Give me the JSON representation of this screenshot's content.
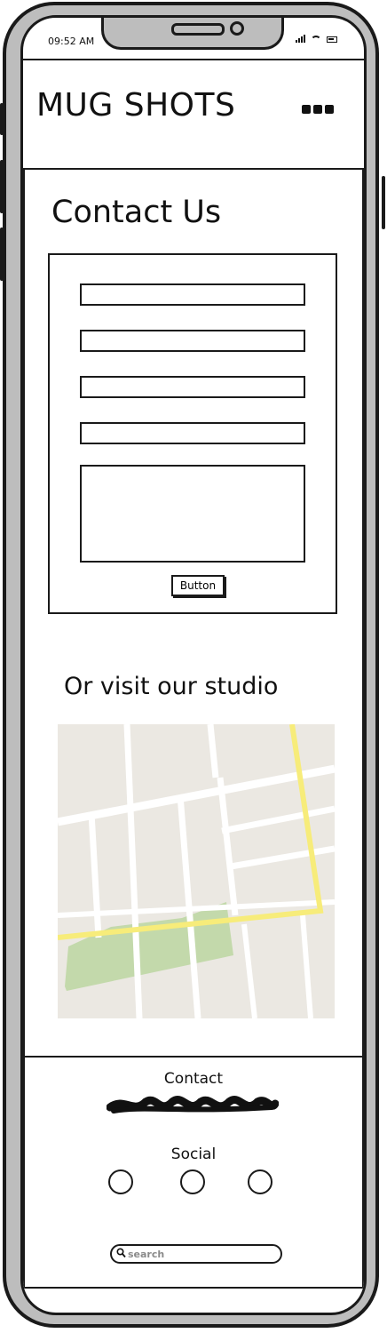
{
  "status_bar": {
    "time": "09:52 AM"
  },
  "header": {
    "brand": "MUG SHOTS",
    "menu_icon": "more-horizontal-icon"
  },
  "contact_form": {
    "title": "Contact Us",
    "button_label": "Button"
  },
  "visit": {
    "heading": "Or visit our studio",
    "map_colors": {
      "land": "#ebe8e2",
      "road": "#ffffff",
      "highlight_road": "#f7ec7a",
      "park": "#c3d9ab"
    }
  },
  "footer": {
    "contact_title": "Contact",
    "social_title": "Social",
    "search_placeholder": "search"
  }
}
